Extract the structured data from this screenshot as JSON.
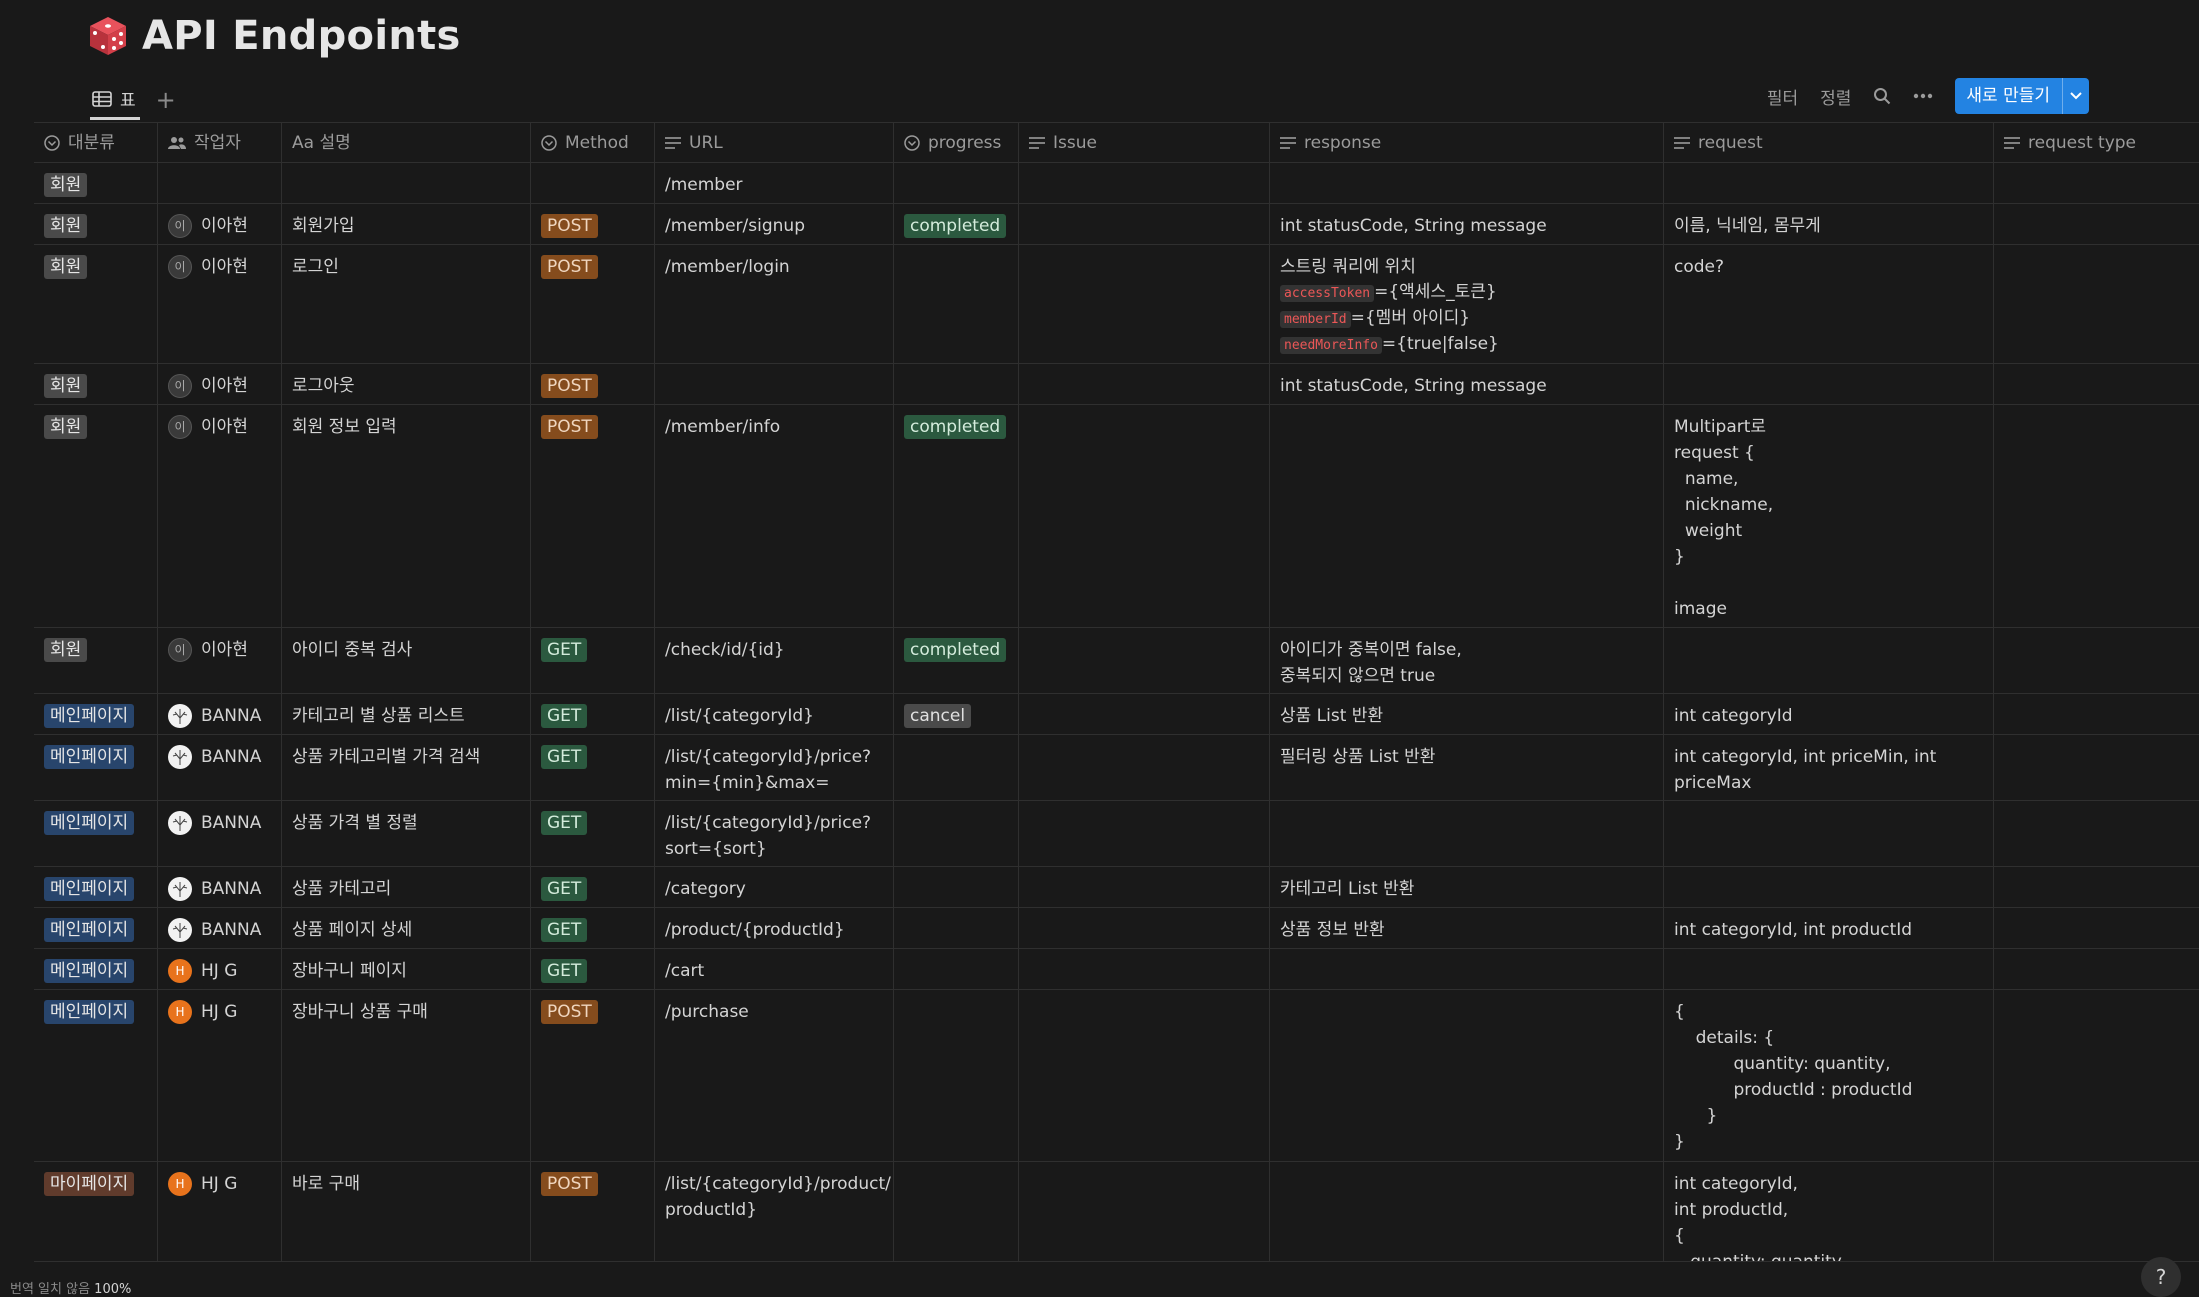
{
  "page": {
    "title": "API Endpoints",
    "icon": "dice-icon"
  },
  "view": {
    "tab_label": "표",
    "add_label": "+"
  },
  "toolbar": {
    "filter": "필터",
    "sort": "정렬",
    "new_button": "새로 만들기"
  },
  "columns": {
    "category": "대분류",
    "worker": "작업자",
    "desc": "Aa 설명",
    "method": "Method",
    "url": "URL",
    "progress": "progress",
    "issue": "Issue",
    "response": "response",
    "request": "request",
    "request_type": "request type"
  },
  "rows": [
    {
      "category": "회원",
      "worker": "",
      "worker_initial": "",
      "desc": "",
      "method": "",
      "url": "/member",
      "progress": "",
      "response": "",
      "request": ""
    },
    {
      "category": "회원",
      "worker": "이아현",
      "worker_initial": "이",
      "desc": "회원가입",
      "method": "POST",
      "url": "/member/signup",
      "progress": "completed",
      "response": "int statusCode, String message",
      "request": "이름, 닉네임, 몸무게"
    },
    {
      "category": "회원",
      "worker": "이아현",
      "worker_initial": "이",
      "desc": "로그인",
      "method": "POST",
      "url": "/member/login",
      "progress": "",
      "response_intro": "스트링 쿼리에 위치",
      "response_params": [
        {
          "code": "accessToken",
          "rest": "={액세스_토큰}"
        },
        {
          "code": "memberId",
          "rest": "={멤버 아이디}"
        },
        {
          "code": "needMoreInfo",
          "rest": "={true|false}"
        }
      ],
      "request": "code?"
    },
    {
      "category": "회원",
      "worker": "이아현",
      "worker_initial": "이",
      "desc": "로그아웃",
      "method": "POST",
      "url": "",
      "progress": "",
      "response": "int statusCode, String message",
      "request": ""
    },
    {
      "category": "회원",
      "worker": "이아현",
      "worker_initial": "이",
      "desc": "회원 정보 입력",
      "method": "POST",
      "url": "/member/info",
      "progress": "completed",
      "response": "",
      "request": "Multipart로\nrequest {\n  name,\n  nickname,\n  weight\n}\n\nimage"
    },
    {
      "category": "회원",
      "worker": "이아현",
      "worker_initial": "이",
      "desc": "아이디 중복 검사",
      "method": "GET",
      "url": "/check/id/{id}",
      "progress": "completed",
      "response": "아이디가 중복이면 false,\n중복되지 않으면 true",
      "request": ""
    },
    {
      "category": "메인페이지",
      "worker": "BANNA",
      "worker_initial": "",
      "desc": "카테고리 별 상품 리스트",
      "method": "GET",
      "url": "/list/{categoryId}",
      "progress": "cancel",
      "response": "상품 List 반환",
      "request": "int categoryId"
    },
    {
      "category": "메인페이지",
      "worker": "BANNA",
      "worker_initial": "",
      "desc": "상품 카테고리별 가격 검색",
      "method": "GET",
      "url": "/list/{categoryId}/price?\nmin={min}&max={max}",
      "progress": "",
      "response": "필터링 상품 List 반환",
      "request": "int categoryId, int priceMin, int\npriceMax"
    },
    {
      "category": "메인페이지",
      "worker": "BANNA",
      "worker_initial": "",
      "desc": "상품 가격 별 정렬",
      "method": "GET",
      "url": "/list/{categoryId}/price?\nsort={sort}",
      "progress": "",
      "response": "",
      "request": ""
    },
    {
      "category": "메인페이지",
      "worker": "BANNA",
      "worker_initial": "",
      "desc": "상품 카테고리",
      "method": "GET",
      "url": "/category",
      "progress": "",
      "response": "카테고리 List 반환",
      "request": ""
    },
    {
      "category": "메인페이지",
      "worker": "BANNA",
      "worker_initial": "",
      "desc": "상품 페이지 상세",
      "method": "GET",
      "url": "/product/{productId}",
      "progress": "",
      "response": "상품 정보 반환",
      "request": "int categoryId, int productId"
    },
    {
      "category": "메인페이지",
      "worker": "HJ G",
      "worker_initial": "H",
      "desc": "장바구니 페이지",
      "method": "GET",
      "url": "/cart",
      "progress": "",
      "response": "",
      "request": ""
    },
    {
      "category": "메인페이지",
      "worker": "HJ G",
      "worker_initial": "H",
      "desc": "장바구니 상품 구매",
      "method": "POST",
      "url": "/purchase",
      "progress": "",
      "response": "",
      "request": "{\n    details: {\n           quantity: quantity,\n           productId : productId\n      }\n}"
    },
    {
      "category": "마이페이지",
      "worker": "HJ G",
      "worker_initial": "H",
      "desc": "바로 구매",
      "method": "POST",
      "url": "/list/{categoryId}/product/{\nproductId}",
      "progress": "",
      "response": "",
      "request": "int categoryId,\nint productId,\n{\n   quantity: quantity"
    }
  ],
  "footer": {
    "label": "번역 일치 않음",
    "value": "100%"
  },
  "help_label": "?"
}
